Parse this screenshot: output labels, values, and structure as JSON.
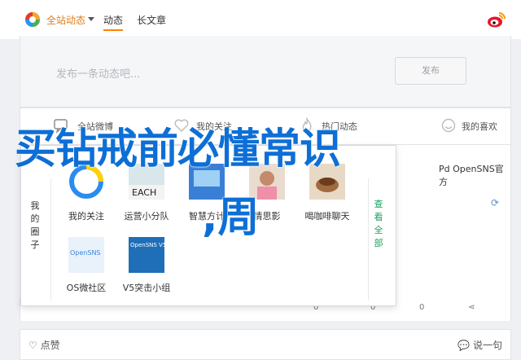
{
  "topbar": {
    "site_name": "全站动态",
    "tabs": [
      {
        "label": "动态",
        "active": true
      },
      {
        "label": "长文章",
        "active": false
      }
    ]
  },
  "composer": {
    "placeholder": "发布一条动态吧...",
    "publish_label": "发布"
  },
  "feed_tabs": [
    {
      "label": "全站微博",
      "icon": "chat-icon"
    },
    {
      "label": "我的关注",
      "icon": "heart-icon"
    },
    {
      "label": "热门动态",
      "icon": "flame-icon"
    },
    {
      "label": "我的喜欢",
      "icon": "smile-icon"
    }
  ],
  "panel": {
    "left_label": "我的圈子",
    "right_label": "查看全部",
    "apps": [
      {
        "label": "我的关注"
      },
      {
        "label": "运营小分队"
      },
      {
        "label": "智慧方计"
      },
      {
        "label": "情思影"
      },
      {
        "label": "喝咖啡聊天"
      },
      {
        "label": "OS微社区",
        "tile_text": "OpenSNS"
      },
      {
        "label": "V5突击小组",
        "tile_text": "OpenSNS V5"
      }
    ]
  },
  "right_card": {
    "title": "Pd OpenSNS官方"
  },
  "post_actions": {
    "like": "0",
    "share": "0",
    "repost": "0",
    "comment": "0"
  },
  "footer": {
    "like_label": "点赞",
    "say_label": "说一句"
  },
  "overlay": {
    "line1": "买钻戒前必懂常识",
    "line2": ",周"
  },
  "colors": {
    "accent": "#ff8200",
    "headline": "#0d6fd6",
    "group_link": "#1a9e5c"
  }
}
